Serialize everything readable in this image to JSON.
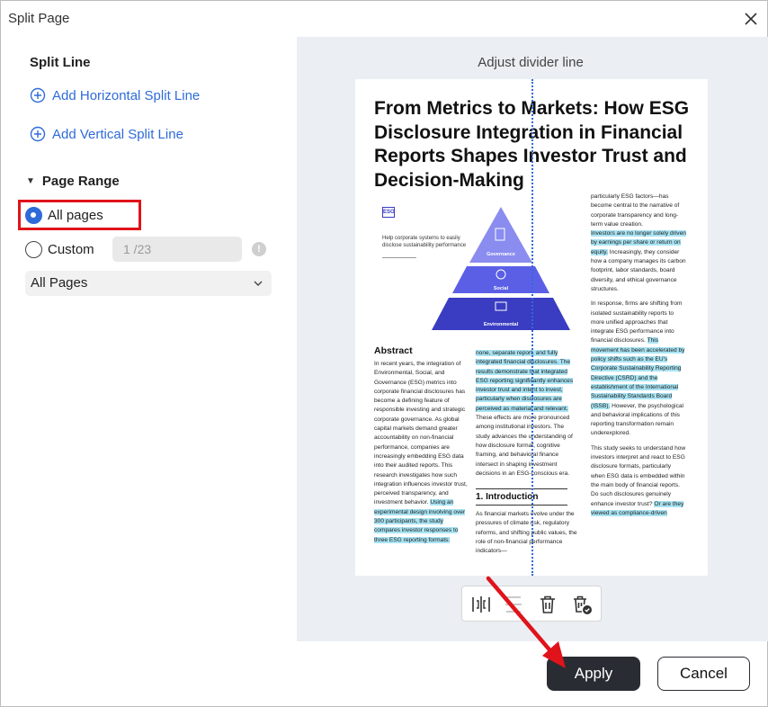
{
  "dialog": {
    "title": "Split Page"
  },
  "left_panel": {
    "split_line_title": "Split Line",
    "add_horizontal": "Add Horizontal Split Line",
    "add_vertical": "Add Vertical Split Line",
    "page_range_title": "Page Range",
    "all_pages_label": "All pages",
    "custom_label": "Custom",
    "custom_placeholder": "1 /23",
    "info_glyph": "!",
    "select_value": "All Pages",
    "selected_option": "All pages"
  },
  "preview": {
    "caption": "Adjust divider line",
    "doc": {
      "title": "From Metrics to Markets: How ESG Disclosure Integration in Financial Reports Shapes Investor Trust and Decision-Making",
      "esg_badge": "ESG",
      "esg_caption": "Help corporate systems to easily disclose sustainability performance",
      "pyramid_levels": [
        "Governance",
        "Social",
        "Environmental"
      ],
      "abstract_title": "Abstract",
      "abstract_text": "In recent years, the integration of Environmental, Social, and Governance (ESG) metrics into corporate financial disclosures has become a defining feature of responsible investing and strategic corporate governance. As global capital markets demand greater accountability on non-financial performance, companies are increasingly embedding ESG data into their audited reports. This research investigates how such integration influences investor trust, perceived transparency, and investment behavior.",
      "abstract_highlight": "Using an experimental design involving over 300 participants, the study compares investor responses to three ESG reporting formats:",
      "middle_highlight": "none, separate report, and fully integrated financial disclosures. The results demonstrate that integrated ESG reporting significantly enhances investor trust and intent to invest, particularly when disclosures are perceived as material and relevant.",
      "middle_text": "These effects are more pronounced among institutional investors. The study advances the understanding of how disclosure format, cognitive framing, and behavioral finance intersect in shaping investment decisions in an ESG-conscious era.",
      "intro_title": "1. Introduction",
      "intro_text": "As financial markets evolve under the pressures of climate risk, regulatory reforms, and shifting public values, the role of non-financial performance indicators—",
      "right_text_1": "particularly ESG factors—has become central to the narrative of corporate transparency and long-term value creation.",
      "right_highlight_1": "Investors are no longer solely driven by earnings per share or return on equity.",
      "right_text_2": "Increasingly, they consider how a company manages its carbon footprint, labor standards, board diversity, and ethical governance structures.",
      "right_text_3": "In response, firms are shifting from isolated sustainability reports to more unified approaches that integrate ESG performance into financial disclosures.",
      "right_highlight_2": "This movement has been accelerated by policy shifts such as the EU's Corporate Sustainability Reporting Directive (CSRD) and the establishment of the International Sustainability Standards Board (ISSB).",
      "right_text_4": "However, the psychological and behavioral implications of this reporting transformation remain underexplored.",
      "right_text_5": "This study seeks to understand how investors interpret and react to ESG disclosure formats, particularly when ESG data is embedded within the main body of financial reports. Do such disclosures genuinely enhance investor trust?",
      "right_highlight_3": "Or are they viewed as compliance-driven"
    }
  },
  "toolbar": {
    "tools": [
      "split-vertical-icon",
      "split-horizontal-icon",
      "delete-icon",
      "delete-all-icon"
    ]
  },
  "buttons": {
    "apply": "Apply",
    "cancel": "Cancel"
  },
  "colors": {
    "accent": "#2f6bd8",
    "highlight_box": "#e0131b",
    "primary_button": "#2a2c33",
    "text_highlight": "#a9e4f4",
    "pyramid_top": "#8a8cf0",
    "pyramid_mid": "#5b5fe6",
    "pyramid_bottom": "#3a3cc2"
  }
}
